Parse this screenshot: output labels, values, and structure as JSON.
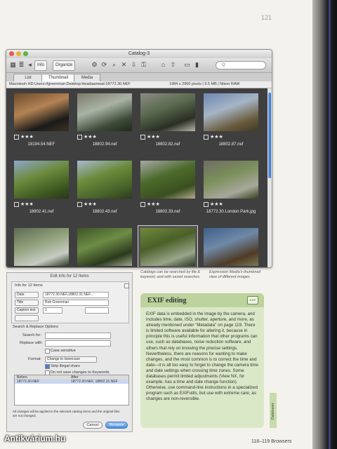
{
  "page": {
    "top_number": "121",
    "footer": "118–119 Browsers",
    "watermark": "Antikvárium.hu"
  },
  "window": {
    "title": "Catalog-3",
    "toolbar": {
      "info_tab": "Info",
      "organize_tab": "Organize",
      "search_placeholder": "Q"
    },
    "tabs": [
      "List",
      "Thumbnail",
      "Media"
    ],
    "path": "Macintosh HD:Users:rfgreenman:Desktop:Headaamwat:18772.30.NEF",
    "meta": "1984 x 2900 pixels  |  9.5 MB  |  Nikon RAW",
    "thumbnails": [
      {
        "name": "18194.54.NEF",
        "stars": "★★★",
        "colors": [
          "#6b4a2c",
          "#b48353",
          "#1a1a1a",
          "#3d3120"
        ]
      },
      {
        "name": "18802.94.nef",
        "stars": "★★★",
        "colors": [
          "#7d7a6a",
          "#a9b3a5",
          "#3d4a37",
          "#1f2a1a"
        ]
      },
      {
        "name": "18802.82.nef",
        "stars": "★★★",
        "colors": [
          "#8b8b83",
          "#5a6a4f",
          "#2a2f24",
          "#b7b6a9"
        ]
      },
      {
        "name": "18802.87.nef",
        "stars": "★★★",
        "colors": [
          "#6d87b2",
          "#a6b5c6",
          "#6a5b3c",
          "#3d3a26"
        ]
      },
      {
        "name": "18802.41.nef",
        "stars": "★★★",
        "colors": [
          "#8ea7c9",
          "#6c8b3d",
          "#3f5a21",
          "#28351a"
        ]
      },
      {
        "name": "18802.43.nef",
        "stars": "★★★",
        "colors": [
          "#a8b9cf",
          "#6b8b3a",
          "#48622a",
          "#2a3b1e"
        ]
      },
      {
        "name": "18802.33.nef",
        "stars": "★★★",
        "colors": [
          "#a7a9a7",
          "#4d6b2b",
          "#3a4f20",
          "#b2a98a"
        ]
      },
      {
        "name": "18772.30.London Park.jpg",
        "stars": "★★★",
        "colors": [
          "#6f6c64",
          "#7a8f5a",
          "#a8a79b",
          "#34411f"
        ]
      },
      {
        "name": "",
        "stars": "★★★",
        "colors": [
          "#5e6a53",
          "#8fa07a",
          "#c7ccc2",
          "#2e3a25"
        ]
      },
      {
        "name": "",
        "stars": "★★★",
        "colors": [
          "#3d5427",
          "#6e8c45",
          "#2a3a1d",
          "#9fa78a"
        ]
      },
      {
        "name": "",
        "stars": "★★★",
        "colors": [
          "#6f8a3c",
          "#4a6028",
          "#9aa58a",
          "#2c3a1f"
        ]
      },
      {
        "name": "",
        "stars": "★★★",
        "colors": [
          "#3f5f8a",
          "#6f89a7",
          "#4f3b25",
          "#7a7a52"
        ]
      }
    ]
  },
  "captions": {
    "left": "Catalogs can be searched by file & keyword, and with saved searches",
    "right": "Expression Media's thumbnail view of different images"
  },
  "dialog": {
    "title": "Edit Info for 12 Items",
    "section1": "Info for 12 Items",
    "rows": [
      {
        "label": "Date",
        "value": "18772.30.NEF,18802.31.NEF..."
      },
      {
        "label": "Title",
        "value": "Rob Greenman"
      },
      {
        "label": "Caption text",
        "value": "1"
      },
      {
        "label": "",
        "value": ""
      }
    ],
    "section2": "Search & Replace Options",
    "search_label": "Search for:",
    "replace_label": "Replace with:",
    "case_label": "Case sensitive",
    "format_label": "Format:",
    "format_value": "Change to lowercase",
    "strip_label": "Strip illegal chars",
    "skip_label": "Do not save changes to Keywords",
    "list_cols": [
      "Before",
      "After"
    ],
    "list_row": "18772.30.NEF",
    "list_row2": "18772.30.NEF, 18802.31.NEF",
    "note": "All changes will be applied to the selected catalog items and the original files are not changed.",
    "cancel": "Cancel",
    "ok": "Rename"
  },
  "exif": {
    "heading": "EXIF editing",
    "icon": "EXIF",
    "body": "EXIF data is embedded in the image by the camera, and includes time, date, ISO, shutter, aperture, and more, as already mentioned under \"Metadata\" on page 119. There is limited software available for altering it, because in principle this is useful information that other programs can use, such as databases, noise reduction software, and others that rely on knowing the precise settings. Nevertheless, there are reasons for wanting to make changes, and the most common is to correct the time and date—it is all too easy to forget to change the camera time and date settings when crossing time zones. Some databases permit limited adjustments (View NX, for example, has a time and date change function). Otherwise, use command-line instructions in a specialized program such as EXIFutils, but use with extreme care, as changes are non-reversible.",
    "side_tab": "Databases"
  }
}
